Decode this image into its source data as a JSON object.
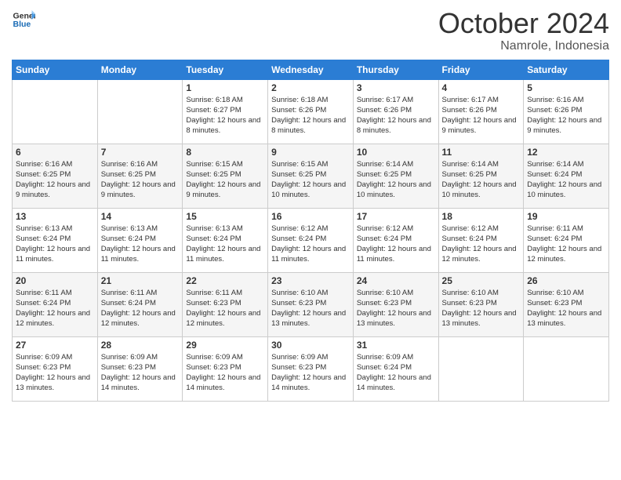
{
  "header": {
    "logo_line1": "General",
    "logo_line2": "Blue",
    "month_year": "October 2024",
    "location": "Namrole, Indonesia"
  },
  "days_of_week": [
    "Sunday",
    "Monday",
    "Tuesday",
    "Wednesday",
    "Thursday",
    "Friday",
    "Saturday"
  ],
  "weeks": [
    [
      {
        "day": "",
        "sunrise": "",
        "sunset": "",
        "daylight": ""
      },
      {
        "day": "",
        "sunrise": "",
        "sunset": "",
        "daylight": ""
      },
      {
        "day": "1",
        "sunrise": "Sunrise: 6:18 AM",
        "sunset": "Sunset: 6:27 PM",
        "daylight": "Daylight: 12 hours and 8 minutes."
      },
      {
        "day": "2",
        "sunrise": "Sunrise: 6:18 AM",
        "sunset": "Sunset: 6:26 PM",
        "daylight": "Daylight: 12 hours and 8 minutes."
      },
      {
        "day": "3",
        "sunrise": "Sunrise: 6:17 AM",
        "sunset": "Sunset: 6:26 PM",
        "daylight": "Daylight: 12 hours and 8 minutes."
      },
      {
        "day": "4",
        "sunrise": "Sunrise: 6:17 AM",
        "sunset": "Sunset: 6:26 PM",
        "daylight": "Daylight: 12 hours and 9 minutes."
      },
      {
        "day": "5",
        "sunrise": "Sunrise: 6:16 AM",
        "sunset": "Sunset: 6:26 PM",
        "daylight": "Daylight: 12 hours and 9 minutes."
      }
    ],
    [
      {
        "day": "6",
        "sunrise": "Sunrise: 6:16 AM",
        "sunset": "Sunset: 6:25 PM",
        "daylight": "Daylight: 12 hours and 9 minutes."
      },
      {
        "day": "7",
        "sunrise": "Sunrise: 6:16 AM",
        "sunset": "Sunset: 6:25 PM",
        "daylight": "Daylight: 12 hours and 9 minutes."
      },
      {
        "day": "8",
        "sunrise": "Sunrise: 6:15 AM",
        "sunset": "Sunset: 6:25 PM",
        "daylight": "Daylight: 12 hours and 9 minutes."
      },
      {
        "day": "9",
        "sunrise": "Sunrise: 6:15 AM",
        "sunset": "Sunset: 6:25 PM",
        "daylight": "Daylight: 12 hours and 10 minutes."
      },
      {
        "day": "10",
        "sunrise": "Sunrise: 6:14 AM",
        "sunset": "Sunset: 6:25 PM",
        "daylight": "Daylight: 12 hours and 10 minutes."
      },
      {
        "day": "11",
        "sunrise": "Sunrise: 6:14 AM",
        "sunset": "Sunset: 6:25 PM",
        "daylight": "Daylight: 12 hours and 10 minutes."
      },
      {
        "day": "12",
        "sunrise": "Sunrise: 6:14 AM",
        "sunset": "Sunset: 6:24 PM",
        "daylight": "Daylight: 12 hours and 10 minutes."
      }
    ],
    [
      {
        "day": "13",
        "sunrise": "Sunrise: 6:13 AM",
        "sunset": "Sunset: 6:24 PM",
        "daylight": "Daylight: 12 hours and 11 minutes."
      },
      {
        "day": "14",
        "sunrise": "Sunrise: 6:13 AM",
        "sunset": "Sunset: 6:24 PM",
        "daylight": "Daylight: 12 hours and 11 minutes."
      },
      {
        "day": "15",
        "sunrise": "Sunrise: 6:13 AM",
        "sunset": "Sunset: 6:24 PM",
        "daylight": "Daylight: 12 hours and 11 minutes."
      },
      {
        "day": "16",
        "sunrise": "Sunrise: 6:12 AM",
        "sunset": "Sunset: 6:24 PM",
        "daylight": "Daylight: 12 hours and 11 minutes."
      },
      {
        "day": "17",
        "sunrise": "Sunrise: 6:12 AM",
        "sunset": "Sunset: 6:24 PM",
        "daylight": "Daylight: 12 hours and 11 minutes."
      },
      {
        "day": "18",
        "sunrise": "Sunrise: 6:12 AM",
        "sunset": "Sunset: 6:24 PM",
        "daylight": "Daylight: 12 hours and 12 minutes."
      },
      {
        "day": "19",
        "sunrise": "Sunrise: 6:11 AM",
        "sunset": "Sunset: 6:24 PM",
        "daylight": "Daylight: 12 hours and 12 minutes."
      }
    ],
    [
      {
        "day": "20",
        "sunrise": "Sunrise: 6:11 AM",
        "sunset": "Sunset: 6:24 PM",
        "daylight": "Daylight: 12 hours and 12 minutes."
      },
      {
        "day": "21",
        "sunrise": "Sunrise: 6:11 AM",
        "sunset": "Sunset: 6:24 PM",
        "daylight": "Daylight: 12 hours and 12 minutes."
      },
      {
        "day": "22",
        "sunrise": "Sunrise: 6:11 AM",
        "sunset": "Sunset: 6:23 PM",
        "daylight": "Daylight: 12 hours and 12 minutes."
      },
      {
        "day": "23",
        "sunrise": "Sunrise: 6:10 AM",
        "sunset": "Sunset: 6:23 PM",
        "daylight": "Daylight: 12 hours and 13 minutes."
      },
      {
        "day": "24",
        "sunrise": "Sunrise: 6:10 AM",
        "sunset": "Sunset: 6:23 PM",
        "daylight": "Daylight: 12 hours and 13 minutes."
      },
      {
        "day": "25",
        "sunrise": "Sunrise: 6:10 AM",
        "sunset": "Sunset: 6:23 PM",
        "daylight": "Daylight: 12 hours and 13 minutes."
      },
      {
        "day": "26",
        "sunrise": "Sunrise: 6:10 AM",
        "sunset": "Sunset: 6:23 PM",
        "daylight": "Daylight: 12 hours and 13 minutes."
      }
    ],
    [
      {
        "day": "27",
        "sunrise": "Sunrise: 6:09 AM",
        "sunset": "Sunset: 6:23 PM",
        "daylight": "Daylight: 12 hours and 13 minutes."
      },
      {
        "day": "28",
        "sunrise": "Sunrise: 6:09 AM",
        "sunset": "Sunset: 6:23 PM",
        "daylight": "Daylight: 12 hours and 14 minutes."
      },
      {
        "day": "29",
        "sunrise": "Sunrise: 6:09 AM",
        "sunset": "Sunset: 6:23 PM",
        "daylight": "Daylight: 12 hours and 14 minutes."
      },
      {
        "day": "30",
        "sunrise": "Sunrise: 6:09 AM",
        "sunset": "Sunset: 6:23 PM",
        "daylight": "Daylight: 12 hours and 14 minutes."
      },
      {
        "day": "31",
        "sunrise": "Sunrise: 6:09 AM",
        "sunset": "Sunset: 6:24 PM",
        "daylight": "Daylight: 12 hours and 14 minutes."
      },
      {
        "day": "",
        "sunrise": "",
        "sunset": "",
        "daylight": ""
      },
      {
        "day": "",
        "sunrise": "",
        "sunset": "",
        "daylight": ""
      }
    ]
  ]
}
